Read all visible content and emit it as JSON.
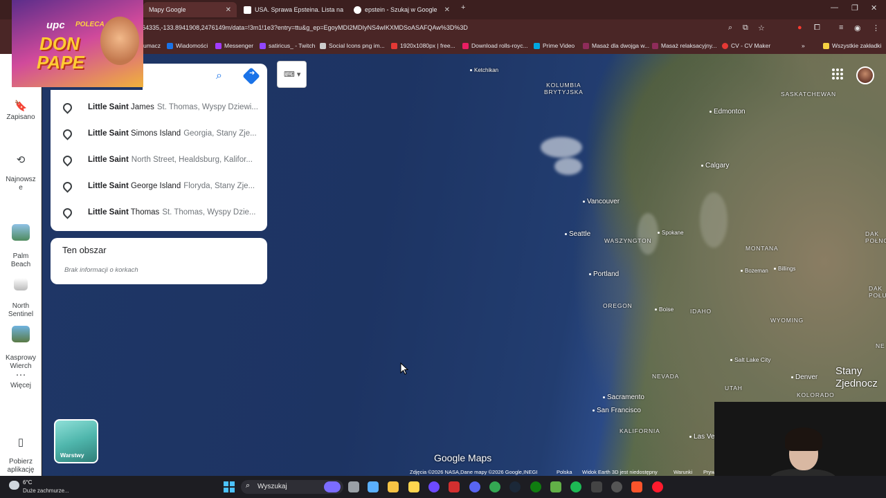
{
  "browser": {
    "tabs": [
      {
        "label": "Mapy Google",
        "color": "#34a853"
      },
      {
        "label": "USA. Sprawa Epsteina. Lista na",
        "color": "#ffffff"
      },
      {
        "label": "epstein - Szukaj w Google",
        "color": "#4285f4"
      }
    ],
    "url": "64335,-133.8941908,2476149m/data=!3m1!1e3?entry=ttu&g_ep=EgoyMDI2MDIyNS4wIKXMDSoASAFQAw%3D%3D",
    "bookmarks": [
      {
        "label": "umacz",
        "color": "#4285f4"
      },
      {
        "label": "Wiadomości",
        "color": "#1a73e8"
      },
      {
        "label": "Messenger",
        "color": "#a33bff"
      },
      {
        "label": "satiricus_ - Twitch",
        "color": "#9146ff"
      },
      {
        "label": "Social Icons png im...",
        "color": "#cccccc"
      },
      {
        "label": "1920x1080px | free...",
        "color": "#e53935"
      },
      {
        "label": "Download rolls-royc...",
        "color": "#e91e63"
      },
      {
        "label": "Prime Video",
        "color": "#00a8e1"
      },
      {
        "label": "Masaż dla dwojga w...",
        "color": "#8e2c5a"
      },
      {
        "label": "Masaż relaksacyjny...",
        "color": "#8e2c5a"
      },
      {
        "label": "CV - CV Maker",
        "color": "#e53935"
      },
      {
        "label": "Wszystkie zakładki",
        "color": "#f5d142"
      }
    ]
  },
  "promo": {
    "brand": "upc",
    "tag": "POLECA",
    "line1": "DON",
    "line2": "PAPE"
  },
  "rail": {
    "items": [
      {
        "label": "Zapisano",
        "icon": "bookmark-icon"
      },
      {
        "label": "Najnowsz\ne",
        "icon": "history-icon"
      },
      {
        "label": "Palm\nBeach",
        "icon": "place-thumbnail"
      },
      {
        "label": "North\nSentinel",
        "icon": "place-thumbnail"
      },
      {
        "label": "Kasprowy\nWierch",
        "icon": "place-thumbnail"
      },
      {
        "label": "Więcej",
        "icon": "more-icon"
      },
      {
        "label": "Pobierz\naplikację",
        "icon": "phone-icon"
      }
    ]
  },
  "search": {
    "suggestions": [
      {
        "main": "Little Saint James",
        "sub": "St. Thomas, Wyspy Dziewi..."
      },
      {
        "main": "Little Saint Simons Island",
        "sub": "Georgia, Stany Zje..."
      },
      {
        "main": "Little Saint",
        "sub": "North Street, Healdsburg, Kalifor..."
      },
      {
        "main": "Little Saint George Island",
        "sub": "Floryda, Stany Zje..."
      },
      {
        "main": "Little Saint Thomas",
        "sub": "St. Thomas, Wyspy Dzie..."
      }
    ]
  },
  "area": {
    "title": "Ten obszar",
    "subtitle": "Brak informacji o korkach"
  },
  "map": {
    "labels": [
      {
        "text": "Ketchikan",
        "type": "city"
      },
      {
        "text": "KOLUMBIA\nBRYTYJSKA",
        "type": "region"
      },
      {
        "text": "SASKATCHEWAN",
        "type": "region"
      },
      {
        "text": "Edmonton",
        "type": "city"
      },
      {
        "text": "Calgary",
        "type": "city"
      },
      {
        "text": "Vancouver",
        "type": "city"
      },
      {
        "text": "Seattle",
        "type": "city"
      },
      {
        "text": "WASZYNGTON",
        "type": "region"
      },
      {
        "text": "Spokane",
        "type": "city"
      },
      {
        "text": "MONTANA",
        "type": "region"
      },
      {
        "text": "Portland",
        "type": "city"
      },
      {
        "text": "Bozeman",
        "type": "city"
      },
      {
        "text": "Billings",
        "type": "city"
      },
      {
        "text": "OREGON",
        "type": "region"
      },
      {
        "text": "Boise",
        "type": "city"
      },
      {
        "text": "IDAHO",
        "type": "region"
      },
      {
        "text": "WYOMING",
        "type": "region"
      },
      {
        "text": "Salt Lake City",
        "type": "city"
      },
      {
        "text": "NEVADA",
        "type": "region"
      },
      {
        "text": "UTAH",
        "type": "region"
      },
      {
        "text": "Denver",
        "type": "city"
      },
      {
        "text": "KOLORADO",
        "type": "region"
      },
      {
        "text": "Sacramento",
        "type": "city"
      },
      {
        "text": "San Francisco",
        "type": "city"
      },
      {
        "text": "KALIFORNIA",
        "type": "region"
      },
      {
        "text": "Las Ve",
        "type": "city"
      },
      {
        "text": "Stany\nZjednocz",
        "type": "country"
      },
      {
        "text": "DAK\nPOŁNO",
        "type": "region"
      },
      {
        "text": "DAK\nPOŁUDN",
        "type": "region"
      },
      {
        "text": "NE",
        "type": "region"
      }
    ],
    "layers_label": "Warstwy",
    "logo": "Google Maps",
    "attribution": "Zdjęcia ©2026 NASA,Dane mapy ©2026 Google,INEGI",
    "country": "Polska",
    "earth_note": "Widok Earth 3D jest niedostępny",
    "terms": "Warunki",
    "privacy": "Pryw"
  },
  "taskbar": {
    "temperature": "6°C",
    "weather": "Duże zachmurze...",
    "search_label": "Wyszukaj",
    "apps": [
      {
        "icon": "widgets-icon",
        "color": "#7b6cff"
      },
      {
        "icon": "task-view-icon",
        "color": "#9aa0a6"
      },
      {
        "icon": "copilot-icon",
        "color": "#5ab0ff"
      },
      {
        "icon": "file-explorer-icon",
        "color": "#f6c344"
      },
      {
        "icon": "store-icon",
        "color": "#ffd54f"
      },
      {
        "icon": "proton-icon",
        "color": "#6d4aff"
      },
      {
        "icon": "lv-icon",
        "color": "#d32f2f"
      },
      {
        "icon": "discord-icon",
        "color": "#5865f2"
      },
      {
        "icon": "chrome-icon",
        "color": "#34a853"
      },
      {
        "icon": "steam-icon",
        "color": "#1b2838"
      },
      {
        "icon": "xbox-icon",
        "color": "#107c10"
      },
      {
        "icon": "minecraft-icon",
        "color": "#62b047"
      },
      {
        "icon": "spotify-icon",
        "color": "#1db954"
      },
      {
        "icon": "game-icon",
        "color": "#444444"
      },
      {
        "icon": "obs-icon",
        "color": "#555555"
      },
      {
        "icon": "brave-icon",
        "color": "#fb542b"
      },
      {
        "icon": "opera-icon",
        "color": "#ff1b2d"
      }
    ]
  }
}
